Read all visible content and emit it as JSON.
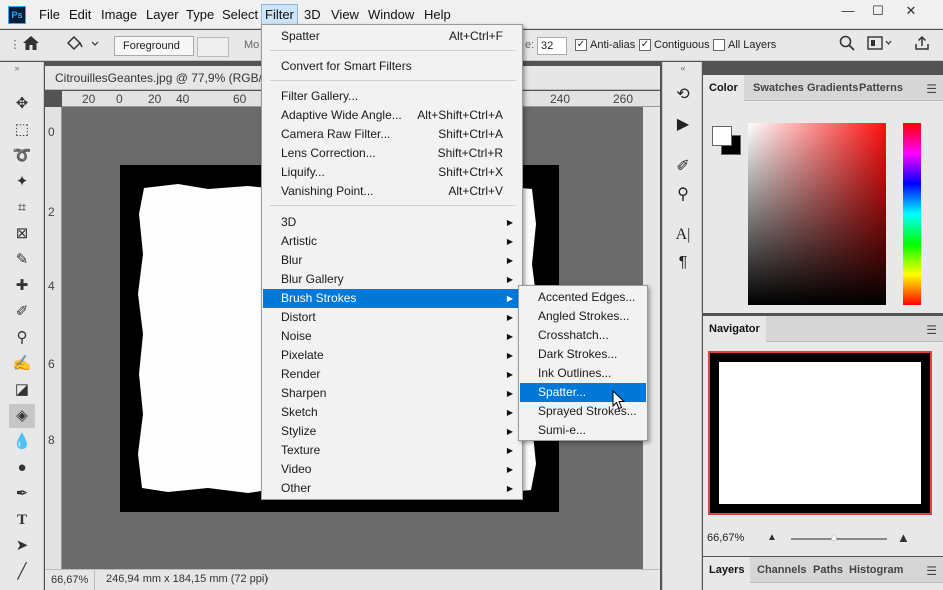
{
  "app": {
    "logo": "Ps"
  },
  "menubar": {
    "items": [
      "File",
      "Edit",
      "Image",
      "Layer",
      "Type",
      "Select",
      "Filter",
      "3D",
      "View",
      "Window",
      "Help"
    ],
    "active": "Filter"
  },
  "window_controls": {
    "minimize": "—",
    "maximize": "☐",
    "close": "✕"
  },
  "options": {
    "fill_source": "Foreground",
    "mode_label": "Mo",
    "tolerance_label": "e:",
    "tolerance": "32",
    "antialias_label": "Anti-alias",
    "antialias": true,
    "contiguous_label": "Contiguous",
    "contiguous": true,
    "all_layers_label": "All Layers",
    "all_layers": false
  },
  "document": {
    "tab_title": "CitrouillesGeantes.jpg @ 77,9% (RGB/8)",
    "ruler_h_marks": [
      "20",
      "0",
      "20",
      "40",
      "60",
      "240",
      "260"
    ],
    "ruler_v_marks": [
      "0",
      "2",
      "4",
      "6",
      "8"
    ],
    "zoom": "66,67%",
    "dimensions": "246,94 mm x 184,15 mm (72 ppi)"
  },
  "filter_menu": {
    "top": {
      "label": "Spatter",
      "shortcut": "Alt+Ctrl+F"
    },
    "smart": {
      "label": "Convert for Smart Filters"
    },
    "group1": [
      {
        "label": "Filter Gallery...",
        "shortcut": ""
      },
      {
        "label": "Adaptive Wide Angle...",
        "shortcut": "Alt+Shift+Ctrl+A"
      },
      {
        "label": "Camera Raw Filter...",
        "shortcut": "Shift+Ctrl+A"
      },
      {
        "label": "Lens Correction...",
        "shortcut": "Shift+Ctrl+R"
      },
      {
        "label": "Liquify...",
        "shortcut": "Shift+Ctrl+X"
      },
      {
        "label": "Vanishing Point...",
        "shortcut": "Alt+Ctrl+V"
      }
    ],
    "submenus": [
      "3D",
      "Artistic",
      "Blur",
      "Blur Gallery",
      "Brush Strokes",
      "Distort",
      "Noise",
      "Pixelate",
      "Render",
      "Sharpen",
      "Sketch",
      "Stylize",
      "Texture",
      "Video",
      "Other"
    ],
    "highlighted": "Brush Strokes"
  },
  "brush_strokes_menu": {
    "items": [
      "Accented Edges...",
      "Angled Strokes...",
      "Crosshatch...",
      "Dark Strokes...",
      "Ink Outlines...",
      "Spatter...",
      "Sprayed Strokes...",
      "Sumi-e..."
    ],
    "highlighted": "Spatter..."
  },
  "color_panel": {
    "tabs": [
      "Color",
      "Swatches",
      "Gradients",
      "Patterns"
    ],
    "active_tab": "Color",
    "foreground": "#ffffff",
    "background": "#000000"
  },
  "navigator": {
    "title": "Navigator",
    "zoom": "66,67%"
  },
  "layers_panel": {
    "tabs": [
      "Layers",
      "Channels",
      "Paths",
      "Histogram"
    ],
    "active_tab": "Layers"
  },
  "colors": {
    "highlight": "#0078d7",
    "nav_frame": "#e04040"
  }
}
